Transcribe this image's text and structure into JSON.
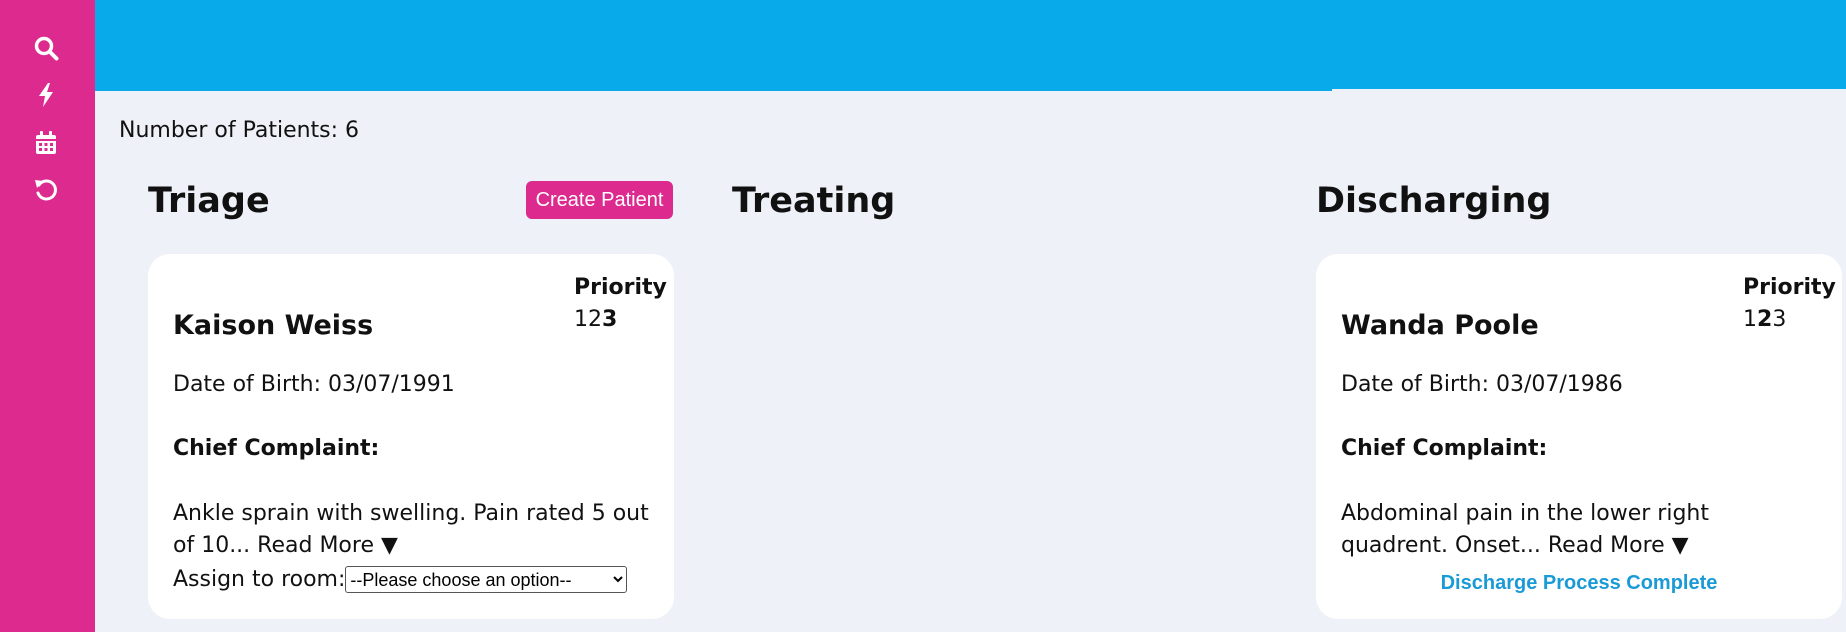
{
  "sidebar": {
    "icons": [
      "search-icon",
      "bolt-icon",
      "calendar-icon",
      "undo-icon"
    ],
    "background": "#dc2a8f"
  },
  "topbar": {
    "background": "#09aaea"
  },
  "patient_count_label": "Number of Patients: 6",
  "columns": {
    "triage": {
      "title": "Triage",
      "create_label": "Create Patient"
    },
    "treating": {
      "title": "Treating"
    },
    "discharging": {
      "title": "Discharging"
    }
  },
  "cards": {
    "kaison": {
      "name": "Kaison Weiss",
      "priority_label": "Priority",
      "priority_digits": [
        "1",
        "2",
        "3"
      ],
      "priority_selected": "3",
      "dob": "Date of Birth: 03/07/1991",
      "chief_complaint_label": "Chief Complaint:",
      "complaint": "Ankle sprain with swelling. Pain rated 5 out of 10...",
      "read_more": "Read More ▼",
      "assign_label": "Assign to room:",
      "assign_selected": "--Please choose an option--"
    },
    "wanda": {
      "name": "Wanda Poole",
      "priority_label": "Priority",
      "priority_digits": [
        "1",
        "2",
        "3"
      ],
      "priority_selected": "2",
      "dob": "Date of Birth: 03/07/1986",
      "chief_complaint_label": "Chief Complaint:",
      "complaint": "Abdominal pain in the lower right quadrent. Onset...",
      "read_more": "Read More ▼",
      "discharge_label": "Discharge Process Complete"
    }
  }
}
